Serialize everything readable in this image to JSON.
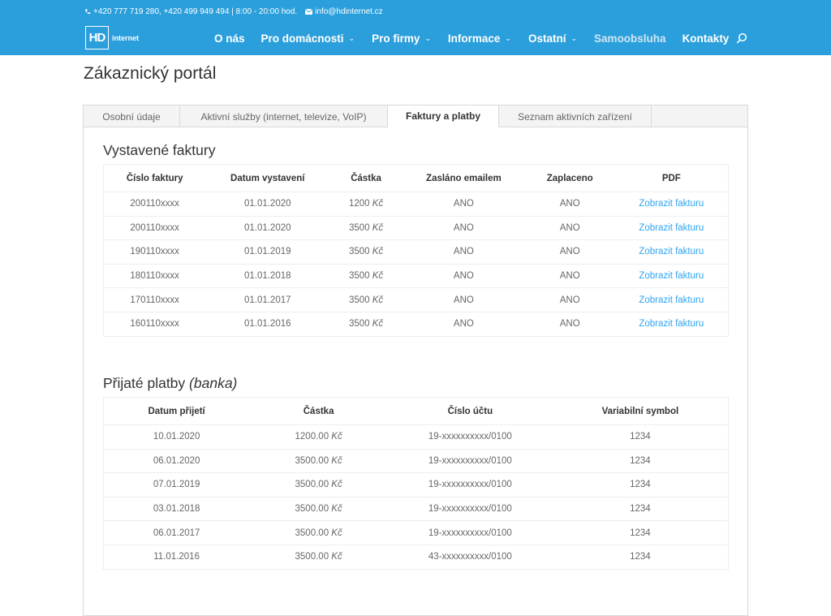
{
  "topbar": {
    "phones": "+420 777 719 280, +420 499 949 494 | 8:00 - 20:00 hod.",
    "email": "info@hdinternet.cz"
  },
  "logo": {
    "mark": "HD",
    "text": "internet"
  },
  "nav": {
    "items": [
      {
        "label": "O nás",
        "dropdown": false
      },
      {
        "label": "Pro domácnosti",
        "dropdown": true
      },
      {
        "label": "Pro firmy",
        "dropdown": true
      },
      {
        "label": "Informace",
        "dropdown": true
      },
      {
        "label": "Ostatní",
        "dropdown": true
      },
      {
        "label": "Samoobsluha",
        "dropdown": false
      },
      {
        "label": "Kontakty",
        "dropdown": false
      }
    ]
  },
  "page_title": "Zákaznický portál",
  "tabs": [
    {
      "label": "Osobní údaje"
    },
    {
      "label": "Aktivní služby (internet, televize, VoIP)"
    },
    {
      "label": "Faktury a platby"
    },
    {
      "label": "Seznam aktivních zařízení"
    }
  ],
  "invoices": {
    "title": "Vystavené faktury",
    "headers": [
      "Číslo faktury",
      "Datum vystavení",
      "Částka",
      "Zasláno emailem",
      "Zaplaceno",
      "PDF"
    ],
    "currency": "Kč",
    "rows": [
      {
        "number": "200110xxxx",
        "date": "01.01.2020",
        "amount": "1200",
        "emailed": "ANO",
        "paid": "ANO",
        "pdf": "Zobrazit fakturu"
      },
      {
        "number": "200110xxxx",
        "date": "01.01.2020",
        "amount": "3500",
        "emailed": "ANO",
        "paid": "ANO",
        "pdf": "Zobrazit fakturu"
      },
      {
        "number": "190110xxxx",
        "date": "01.01.2019",
        "amount": "3500",
        "emailed": "ANO",
        "paid": "ANO",
        "pdf": "Zobrazit fakturu"
      },
      {
        "number": "180110xxxx",
        "date": "01.01.2018",
        "amount": "3500",
        "emailed": "ANO",
        "paid": "ANO",
        "pdf": "Zobrazit fakturu"
      },
      {
        "number": "170110xxxx",
        "date": "01.01.2017",
        "amount": "3500",
        "emailed": "ANO",
        "paid": "ANO",
        "pdf": "Zobrazit fakturu"
      },
      {
        "number": "160110xxxx",
        "date": "01.01.2016",
        "amount": "3500",
        "emailed": "ANO",
        "paid": "ANO",
        "pdf": "Zobrazit fakturu"
      }
    ]
  },
  "payments": {
    "title": "Přijaté platby",
    "title_suffix": "(banka)",
    "headers": [
      "Datum přijetí",
      "Částka",
      "Číslo účtu",
      "Variabilní symbol"
    ],
    "currency": "Kč",
    "rows": [
      {
        "date": "10.01.2020",
        "amount": "1200.00",
        "account": "19-xxxxxxxxxx/0100",
        "vs": "1234"
      },
      {
        "date": "06.01.2020",
        "amount": "3500.00",
        "account": "19-xxxxxxxxxx/0100",
        "vs": "1234"
      },
      {
        "date": "07.01.2019",
        "amount": "3500.00",
        "account": "19-xxxxxxxxxx/0100",
        "vs": "1234"
      },
      {
        "date": "03.01.2018",
        "amount": "3500.00",
        "account": "19-xxxxxxxxxx/0100",
        "vs": "1234"
      },
      {
        "date": "06.01.2017",
        "amount": "3500.00",
        "account": "19-xxxxxxxxxx/0100",
        "vs": "1234"
      },
      {
        "date": "11.01.2016",
        "amount": "3500.00",
        "account": "43-xxxxxxxxxx/0100",
        "vs": "1234"
      }
    ]
  },
  "colors": {
    "header_bg": "#2b9fdc",
    "link": "#2ea3f2",
    "nav_muted": "#cfe6f3"
  },
  "icons": {
    "phone": "phone-icon",
    "email": "envelope-icon",
    "search": "search-icon",
    "dropdown": "chevron-down-icon"
  }
}
